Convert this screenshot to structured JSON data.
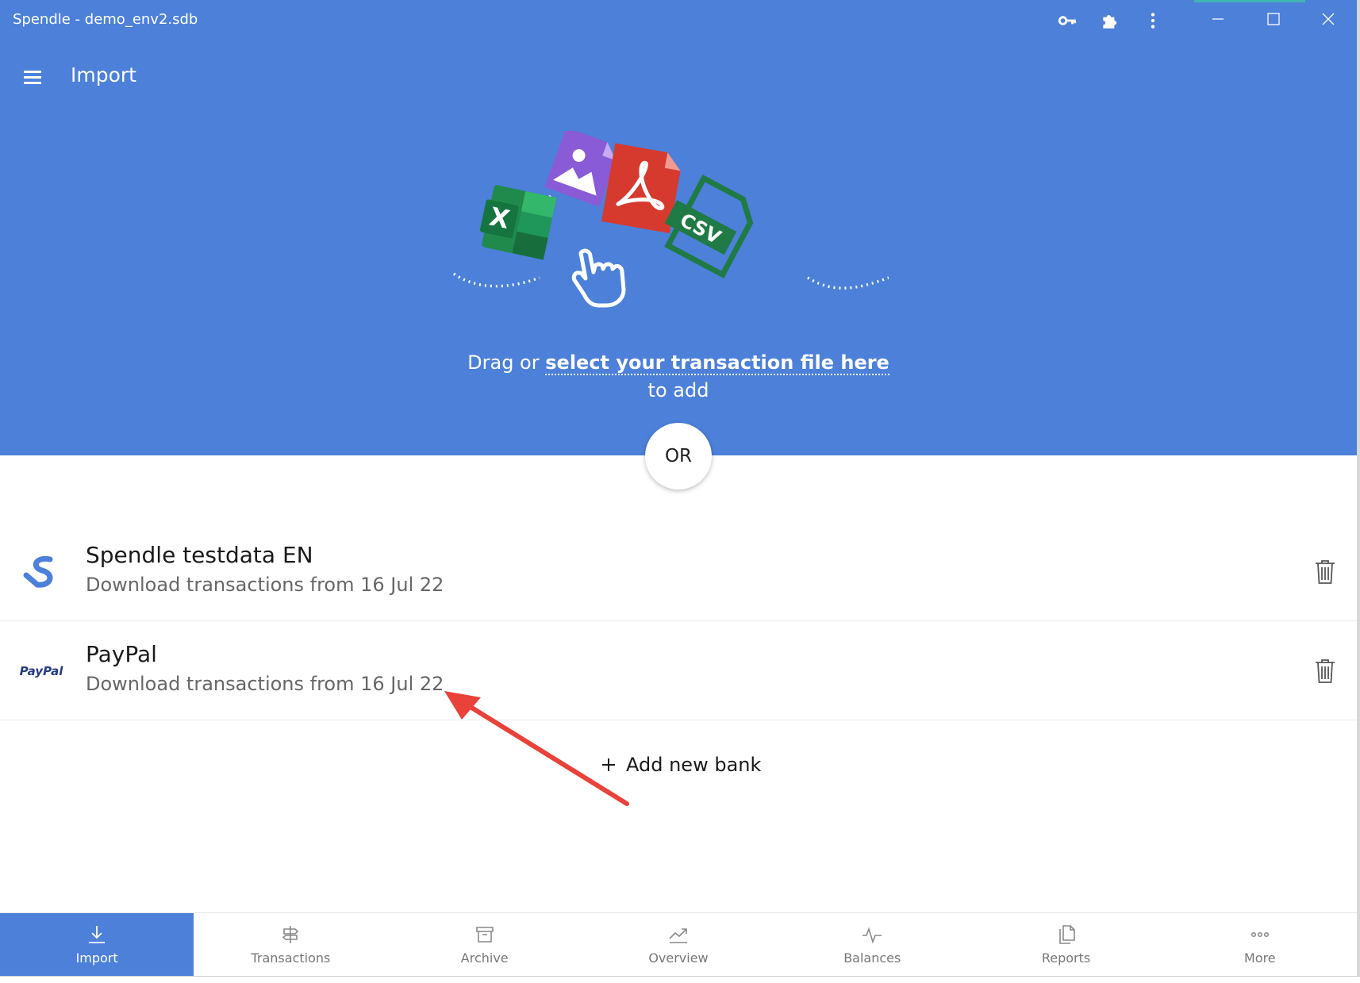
{
  "window": {
    "title": "Spendle - demo_env2.sdb"
  },
  "appbar": {
    "title": "Import"
  },
  "dropzone": {
    "prefix": "Drag or ",
    "link": "select your transaction file here",
    "suffix": "to add",
    "file_types": [
      "image",
      "pdf",
      "excel",
      "csv"
    ],
    "csv_label": "CSV",
    "excel_label": "X"
  },
  "separator": {
    "label": "OR"
  },
  "banks": [
    {
      "name": "Spendle testdata EN",
      "subtitle": "Download transactions from 16 Jul 22",
      "logo": "spendle-logo"
    },
    {
      "name": "PayPal",
      "subtitle": "Download transactions from 16 Jul 22",
      "logo": "paypal-logo",
      "logo_text": "PayPal"
    }
  ],
  "add_bank": {
    "label": "Add new bank"
  },
  "nav": [
    {
      "label": "Import",
      "icon": "download-icon",
      "active": true
    },
    {
      "label": "Transactions",
      "icon": "signpost-icon",
      "active": false
    },
    {
      "label": "Archive",
      "icon": "archive-icon",
      "active": false
    },
    {
      "label": "Overview",
      "icon": "trend-icon",
      "active": false
    },
    {
      "label": "Balances",
      "icon": "pulse-icon",
      "active": false
    },
    {
      "label": "Reports",
      "icon": "reports-icon",
      "active": false
    },
    {
      "label": "More",
      "icon": "more-dots-icon",
      "active": false
    }
  ],
  "colors": {
    "primary": "#4c80d9",
    "annotation_arrow": "#e8423a",
    "pdf": "#d63a2f",
    "excel": "#1f8a4c",
    "image": "#8a5bd6",
    "csv": "#1f7a45"
  }
}
